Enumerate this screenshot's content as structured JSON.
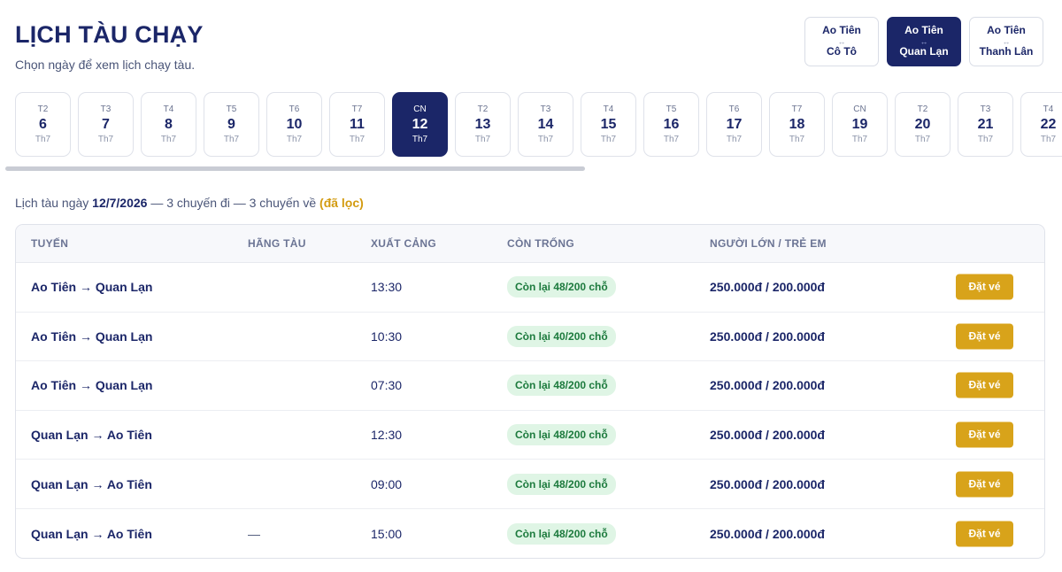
{
  "header": {
    "title": "LỊCH TÀU CHẠY",
    "subtitle": "Chọn ngày để xem lịch chạy tàu."
  },
  "routes": [
    {
      "from": "Ao Tiên",
      "arrow": "↔",
      "to": "Cô Tô",
      "active": false
    },
    {
      "from": "Ao Tiên",
      "arrow": "↔",
      "to": "Quan Lạn",
      "active": true
    },
    {
      "from": "Ao Tiên",
      "arrow": "↔",
      "to": "Thanh Lân",
      "active": false
    }
  ],
  "dates": [
    {
      "dow": "T2",
      "day": "6",
      "mon": "Th7"
    },
    {
      "dow": "T3",
      "day": "7",
      "mon": "Th7"
    },
    {
      "dow": "T4",
      "day": "8",
      "mon": "Th7"
    },
    {
      "dow": "T5",
      "day": "9",
      "mon": "Th7"
    },
    {
      "dow": "T6",
      "day": "10",
      "mon": "Th7"
    },
    {
      "dow": "T7",
      "day": "11",
      "mon": "Th7"
    },
    {
      "dow": "CN",
      "day": "12",
      "mon": "Th7",
      "active": true
    },
    {
      "dow": "T2",
      "day": "13",
      "mon": "Th7"
    },
    {
      "dow": "T3",
      "day": "14",
      "mon": "Th7"
    },
    {
      "dow": "T4",
      "day": "15",
      "mon": "Th7"
    },
    {
      "dow": "T5",
      "day": "16",
      "mon": "Th7"
    },
    {
      "dow": "T6",
      "day": "17",
      "mon": "Th7"
    },
    {
      "dow": "T7",
      "day": "18",
      "mon": "Th7"
    },
    {
      "dow": "CN",
      "day": "19",
      "mon": "Th7"
    },
    {
      "dow": "T2",
      "day": "20",
      "mon": "Th7"
    },
    {
      "dow": "T3",
      "day": "21",
      "mon": "Th7"
    },
    {
      "dow": "T4",
      "day": "22",
      "mon": "Th7"
    }
  ],
  "summary": {
    "prefix": "Lịch tàu ngày ",
    "date": "12/7/2026",
    "counts": " — 3 chuyến đi — 3 chuyến về ",
    "filtered": "(đã lọc)"
  },
  "table": {
    "headers": {
      "route": "TUYẾN",
      "operator": "HÃNG TÀU",
      "departure": "XUẤT CẢNG",
      "seats": "CÒN TRỐNG",
      "price": "NGƯỜI LỚN / TRẺ EM"
    },
    "book_label": "Đặt vé",
    "rows": [
      {
        "route": "Ao Tiên → Quan Lạn",
        "operator": "",
        "time": "13:30",
        "seats": "Còn lại 48/200 chỗ",
        "price": "250.000đ / 200.000đ"
      },
      {
        "route": "Ao Tiên → Quan Lạn",
        "operator": "",
        "time": "10:30",
        "seats": "Còn lại 40/200 chỗ",
        "price": "250.000đ / 200.000đ"
      },
      {
        "route": "Ao Tiên → Quan Lạn",
        "operator": "",
        "time": "07:30",
        "seats": "Còn lại 48/200 chỗ",
        "price": "250.000đ / 200.000đ"
      },
      {
        "route": "Quan Lạn → Ao Tiên",
        "operator": "",
        "time": "12:30",
        "seats": "Còn lại 48/200 chỗ",
        "price": "250.000đ / 200.000đ"
      },
      {
        "route": "Quan Lạn → Ao Tiên",
        "operator": "",
        "time": "09:00",
        "seats": "Còn lại 48/200 chỗ",
        "price": "250.000đ / 200.000đ"
      },
      {
        "route": "Quan Lạn → Ao Tiên",
        "operator": "—",
        "time": "15:00",
        "seats": "Còn lại 48/200 chỗ",
        "price": "250.000đ / 200.000đ"
      }
    ]
  }
}
